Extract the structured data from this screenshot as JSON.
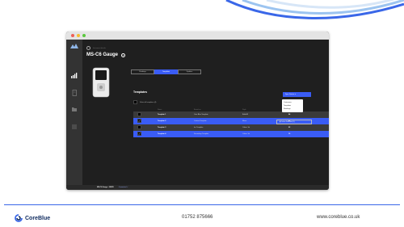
{
  "window": {
    "breadcrumb": "Instrument details",
    "title": "MS-C6 Gauge",
    "help_glyph": "?"
  },
  "tabs": [
    {
      "label": "Readings",
      "active": false
    },
    {
      "label": "Templates",
      "active": true
    },
    {
      "label": "Updates",
      "active": false
    }
  ],
  "section": {
    "title": "Templates",
    "select_all_label": "Select all templates (4)"
  },
  "actions": {
    "sync_label": "Sync Device",
    "sync_chevron": "▾",
    "dropdown": [
      "Customers",
      "Templates",
      "Readings"
    ],
    "delete_label": "Delete Selected (2)"
  },
  "table": {
    "headers": [
      "Name",
      "Based on",
      "Style",
      "Preset"
    ],
    "rows": [
      {
        "checked": false,
        "name": "Template 1",
        "based": "Core Blue Template",
        "style": "Bold A3",
        "preset": "04"
      },
      {
        "checked": true,
        "name": "Template 2",
        "based": "Custom Template",
        "style": "Mono",
        "preset": "03"
      },
      {
        "checked": false,
        "name": "Template 3",
        "based": "Ice Template",
        "style": "Colour 1st",
        "preset": "02"
      },
      {
        "checked": true,
        "name": "Template 4",
        "based": "Secondary Template",
        "style": "Colour 1st",
        "preset": "10"
      }
    ]
  },
  "statusbar": {
    "device": "MS-C6 Gauge - 0003D",
    "state": "Connected",
    "state_icon": "✓"
  },
  "footer": {
    "brand": "CoreBlue",
    "phone": "01752 875666",
    "website": "www.coreblue.co.uk"
  },
  "colors": {
    "accent": "#3a5cf5",
    "window_bg": "#1f1f1f",
    "brand_navy": "#0e2a5e"
  }
}
